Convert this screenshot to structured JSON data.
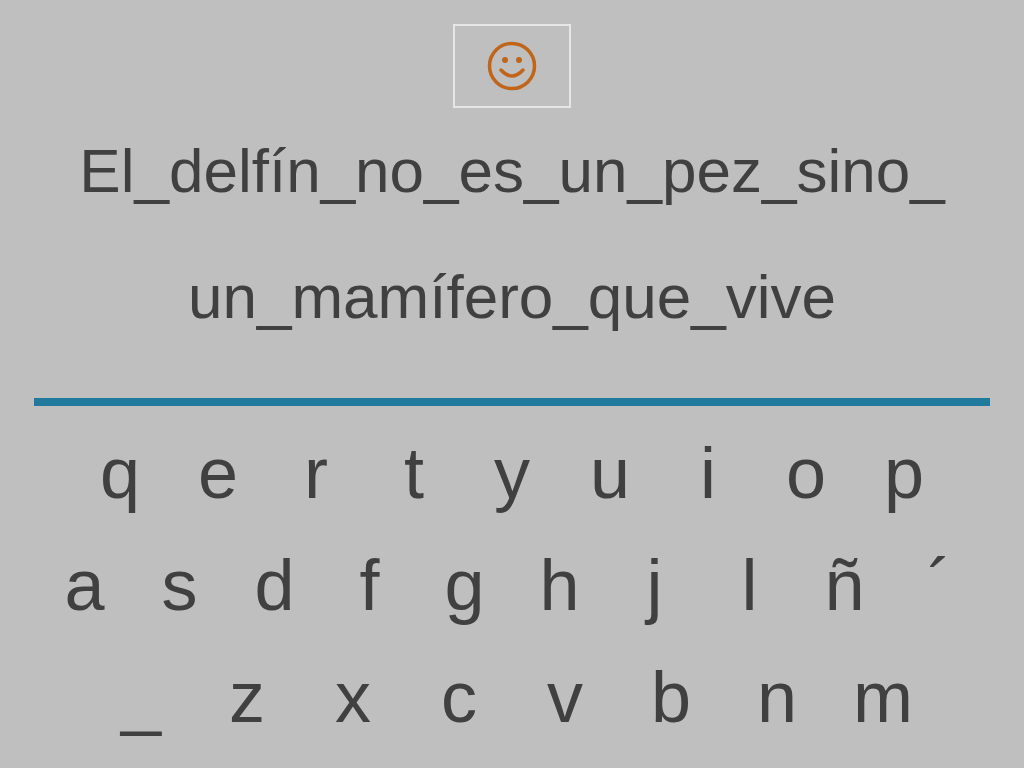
{
  "sentence_lines": [
    "El_delfín_no_es_un_pez_sino_",
    "un_mamífero_que_vive"
  ],
  "keyboard_rows": [
    [
      "q",
      "e",
      "r",
      "t",
      "y",
      "u",
      "i",
      "o",
      "p"
    ],
    [
      "a",
      "s",
      "d",
      "f",
      "g",
      "h",
      "j",
      "l",
      "ñ",
      "´"
    ],
    [
      "_",
      "z",
      "x",
      "c",
      "v",
      "b",
      "n",
      "m"
    ]
  ]
}
